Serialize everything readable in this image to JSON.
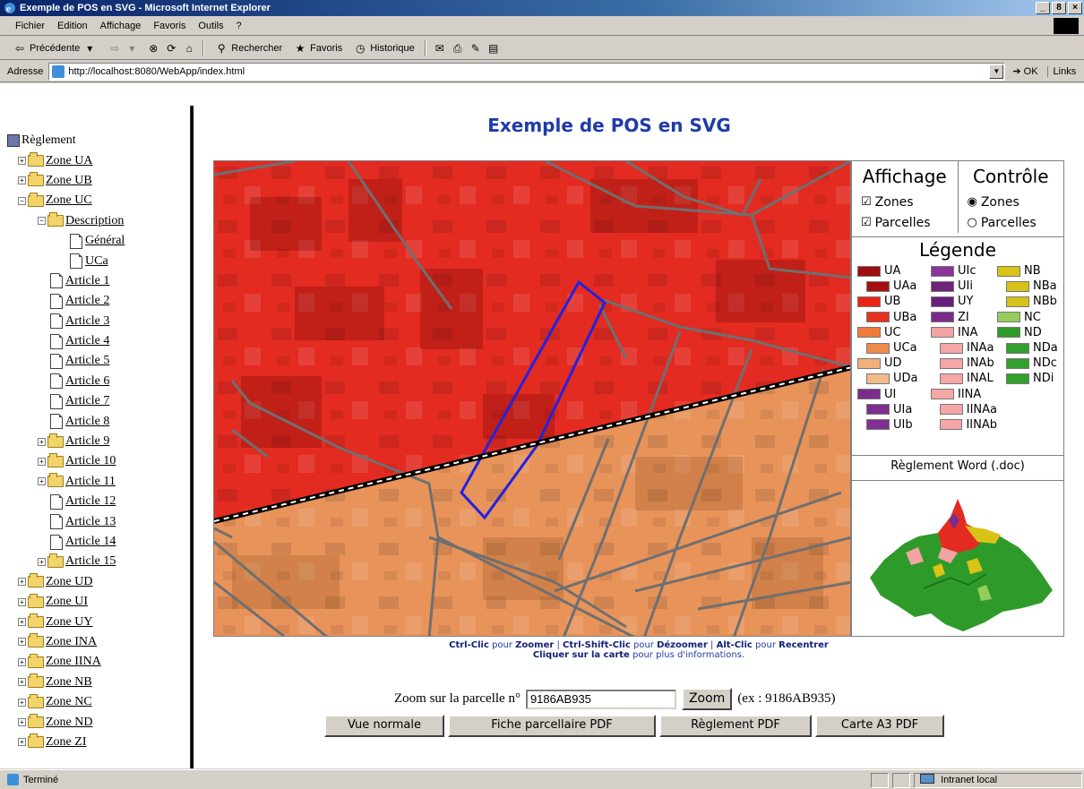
{
  "window": {
    "title": "Exemple de POS en SVG - Microsoft Internet Explorer",
    "min": "_",
    "max": "8",
    "close": "×"
  },
  "menu": [
    "Fichier",
    "Edition",
    "Affichage",
    "Favoris",
    "Outils",
    "?"
  ],
  "toolbar": {
    "back": "Précédente",
    "search": "Rechercher",
    "favorites": "Favoris",
    "history": "Historique"
  },
  "address": {
    "label": "Adresse",
    "url": "http://localhost:8080/WebApp/index.html",
    "go": "OK",
    "links": "Links"
  },
  "tree": {
    "root": "Règlement",
    "items": [
      {
        "label": "Zone UA",
        "level": 0,
        "pm": "+",
        "icon": "folder"
      },
      {
        "label": "Zone UB",
        "level": 0,
        "pm": "+",
        "icon": "folder"
      },
      {
        "label": "Zone UC",
        "level": 0,
        "pm": "−",
        "icon": "folder"
      },
      {
        "label": "Description",
        "level": 1,
        "pm": "−",
        "icon": "folder"
      },
      {
        "label": "Général",
        "level": 2,
        "pm": "",
        "icon": "doc"
      },
      {
        "label": "UCa",
        "level": 2,
        "pm": "",
        "icon": "doc"
      },
      {
        "label": "Article 1",
        "level": 1,
        "pm": "",
        "icon": "doc"
      },
      {
        "label": "Article 2",
        "level": 1,
        "pm": "",
        "icon": "doc"
      },
      {
        "label": "Article 3",
        "level": 1,
        "pm": "",
        "icon": "doc"
      },
      {
        "label": "Article 4",
        "level": 1,
        "pm": "",
        "icon": "doc"
      },
      {
        "label": "Article 5",
        "level": 1,
        "pm": "",
        "icon": "doc"
      },
      {
        "label": "Article 6",
        "level": 1,
        "pm": "",
        "icon": "doc"
      },
      {
        "label": "Article 7",
        "level": 1,
        "pm": "",
        "icon": "doc"
      },
      {
        "label": "Article 8",
        "level": 1,
        "pm": "",
        "icon": "doc"
      },
      {
        "label": "Article 9",
        "level": 1,
        "pm": "+",
        "icon": "folder"
      },
      {
        "label": "Article 10",
        "level": 1,
        "pm": "+",
        "icon": "folder"
      },
      {
        "label": "Article 11",
        "level": 1,
        "pm": "+",
        "icon": "folder"
      },
      {
        "label": "Article 12",
        "level": 1,
        "pm": "",
        "icon": "doc"
      },
      {
        "label": "Article 13",
        "level": 1,
        "pm": "",
        "icon": "doc"
      },
      {
        "label": "Article 14",
        "level": 1,
        "pm": "",
        "icon": "doc"
      },
      {
        "label": "Article 15",
        "level": 1,
        "pm": "+",
        "icon": "folder"
      },
      {
        "label": "Zone UD",
        "level": 0,
        "pm": "+",
        "icon": "folder"
      },
      {
        "label": "Zone UI",
        "level": 0,
        "pm": "+",
        "icon": "folder"
      },
      {
        "label": "Zone UY",
        "level": 0,
        "pm": "+",
        "icon": "folder"
      },
      {
        "label": "Zone INA",
        "level": 0,
        "pm": "+",
        "icon": "folder"
      },
      {
        "label": "Zone IINA",
        "level": 0,
        "pm": "+",
        "icon": "folder"
      },
      {
        "label": "Zone NB",
        "level": 0,
        "pm": "+",
        "icon": "folder"
      },
      {
        "label": "Zone NC",
        "level": 0,
        "pm": "+",
        "icon": "folder"
      },
      {
        "label": "Zone ND",
        "level": 0,
        "pm": "+",
        "icon": "folder"
      },
      {
        "label": "Zone ZI",
        "level": 0,
        "pm": "+",
        "icon": "folder"
      }
    ]
  },
  "page": {
    "title": "Exemple de POS en SVG"
  },
  "panel": {
    "display_title": "Affichage",
    "control_title": "Contrôle",
    "display_zones": "Zones",
    "display_parcels": "Parcelles",
    "control_zones": "Zones",
    "control_parcels": "Parcelles",
    "legend_title": "Légende",
    "word_link": "Règlement Word (.doc)"
  },
  "legend": {
    "col1": [
      {
        "label": "UA",
        "color": "#9c0e10"
      },
      {
        "label": "UAa",
        "color": "#a5100f",
        "indent": true
      },
      {
        "label": "UB",
        "color": "#e82316"
      },
      {
        "label": "UBa",
        "color": "#e8321f",
        "indent": true
      },
      {
        "label": "UC",
        "color": "#ef7a3c"
      },
      {
        "label": "UCa",
        "color": "#f08a4b",
        "indent": true
      },
      {
        "label": "UD",
        "color": "#f2b07a"
      },
      {
        "label": "UDa",
        "color": "#f2b98a",
        "indent": true
      },
      {
        "label": "UI",
        "color": "#7b2c8c"
      },
      {
        "label": "UIa",
        "color": "#7e2e90",
        "indent": true
      },
      {
        "label": "UIb",
        "color": "#812f94",
        "indent": true
      }
    ],
    "col2": [
      {
        "label": "UIc",
        "color": "#8a3599"
      },
      {
        "label": "UIi",
        "color": "#6d2479"
      },
      {
        "label": "UY",
        "color": "#6a1f7b"
      },
      {
        "label": "ZI",
        "color": "#7a2b8e"
      },
      {
        "label": "INA",
        "color": "#f2a3a3"
      },
      {
        "label": "INAa",
        "color": "#f4a7a5",
        "indent": true
      },
      {
        "label": "INAb",
        "color": "#f4a7a5",
        "indent": true
      },
      {
        "label": "INAL",
        "color": "#f4a7a5",
        "indent": true
      },
      {
        "label": "IINA",
        "color": "#f4a7a5"
      },
      {
        "label": "IINAa",
        "color": "#f4a7a5",
        "indent": true
      },
      {
        "label": "IINAb",
        "color": "#f4a7a5",
        "indent": true
      }
    ],
    "col3": [
      {
        "label": "NB",
        "color": "#d9c317"
      },
      {
        "label": "NBa",
        "color": "#d6c21a",
        "indent": true
      },
      {
        "label": "NBb",
        "color": "#d6c21a",
        "indent": true
      },
      {
        "label": "NC",
        "color": "#96cc5c"
      },
      {
        "label": "ND",
        "color": "#2e9a2a"
      },
      {
        "label": "NDa",
        "color": "#31a02c",
        "indent": true
      },
      {
        "label": "NDc",
        "color": "#31a02c",
        "indent": true
      },
      {
        "label": "NDi",
        "color": "#31a02c",
        "indent": true
      }
    ]
  },
  "help": {
    "k1": "Ctrl-Clic",
    "t1": " pour ",
    "a1": "Zoomer",
    "sep1": " | ",
    "k2": "Ctrl-Shift-Clic",
    "t2": " pour ",
    "a2": "Dézoomer",
    "sep2": " | ",
    "k3": "Alt-Clic",
    "t3": " pour ",
    "a3": "Recentrer",
    "line2b": "Cliquer sur la carte",
    "line2": " pour plus d'informations."
  },
  "zoom": {
    "label": "Zoom sur la parcelle n°",
    "value": "9186AB935",
    "button": "Zoom",
    "example": "(ex : 9186AB935)"
  },
  "buttons": [
    "Vue normale",
    "Fiche parcellaire PDF",
    "Règlement PDF",
    "Carte A3 PDF"
  ],
  "status": {
    "text": "Terminé",
    "zone": "Intranet local"
  }
}
